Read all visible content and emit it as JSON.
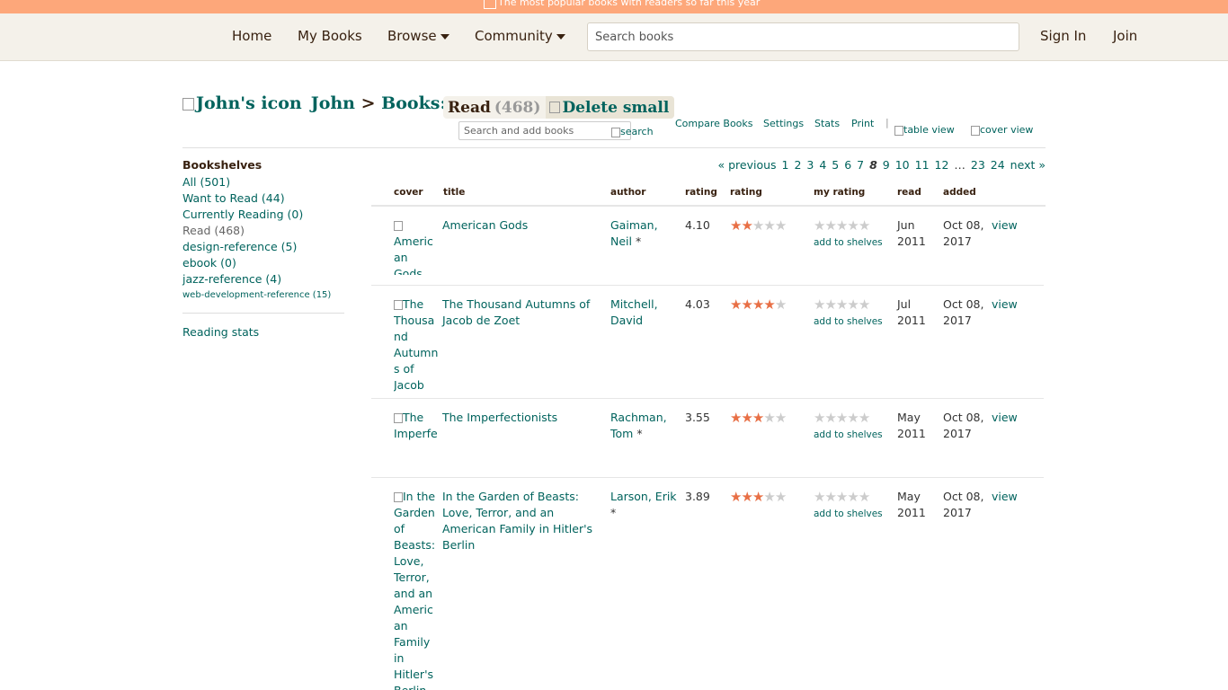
{
  "banner": {
    "text": "The most popular books with readers so far this year"
  },
  "nav": {
    "home": "Home",
    "my_books": "My Books",
    "browse": "Browse",
    "community": "Community",
    "search_placeholder": "Search books",
    "sign_in": "Sign In",
    "join": "Join"
  },
  "header": {
    "user_icon_alt": "John's icon",
    "user_name": "John",
    "separator": ">",
    "books_label": "Books:",
    "shelf_name": "Read",
    "shelf_count": "(468)",
    "delete_label": "Delete small",
    "add_books_placeholder": "Search and add books",
    "search_label": "search"
  },
  "controls": {
    "compare": "Compare Books",
    "settings": "Settings",
    "stats": "Stats",
    "print": "Print",
    "pipe": "|",
    "table_view": "table view",
    "cover_view": "cover view"
  },
  "sidebar": {
    "title": "Bookshelves",
    "shelves": [
      {
        "label": "All (501)"
      },
      {
        "label": "Want to Read (44)"
      },
      {
        "label": "Currently Reading (0)"
      },
      {
        "label": "Read (468)"
      },
      {
        "label": "design-reference (5)"
      },
      {
        "label": "ebook (0)"
      },
      {
        "label": "jazz-reference (4)"
      },
      {
        "label": "web-development-reference (15)"
      }
    ],
    "reading_stats": "Reading stats"
  },
  "pagination": {
    "previous": "« previous",
    "pages": [
      "1",
      "2",
      "3",
      "4",
      "5",
      "6",
      "7"
    ],
    "current": "8",
    "pages_after": [
      "9",
      "10",
      "11",
      "12"
    ],
    "ellipsis": "…",
    "last_pages": [
      "23",
      "24"
    ],
    "next": "next »"
  },
  "columns": {
    "cover": "cover",
    "title": "title",
    "author": "author",
    "avg_rating": "rating",
    "rating": "rating",
    "my_rating": "my rating",
    "read": "read",
    "added": "added"
  },
  "books": [
    {
      "cover_alt": "American Gods",
      "title": "American Gods",
      "author_line1": "Gaiman,",
      "author_line2": "Neil",
      "author_star": "*",
      "avg": "4.10",
      "rating_stars": 2,
      "read_month": "Jun",
      "read_year": "2011",
      "added_line1": "Oct 08,",
      "added_line2": "2017",
      "view": "view",
      "add_shelves": "add to shelves"
    },
    {
      "cover_alt": "The Thousand Autumns of Jacob de Zoet",
      "title": "The Thousand Autumns of Jacob de Zoet",
      "author_line1": "Mitchell,",
      "author_line2": "David",
      "author_star": "",
      "avg": "4.03",
      "rating_stars": 4,
      "read_month": "Jul",
      "read_year": "2011",
      "added_line1": "Oct 08,",
      "added_line2": "2017",
      "view": "view",
      "add_shelves": "add to shelves"
    },
    {
      "cover_alt": "The Imperfectionists",
      "title": "The Imperfectionists",
      "author_line1": "Rachman,",
      "author_line2": "Tom",
      "author_star": "*",
      "avg": "3.55",
      "rating_stars": 3,
      "read_month": "May",
      "read_year": "2011",
      "added_line1": "Oct 08,",
      "added_line2": "2017",
      "view": "view",
      "add_shelves": "add to shelves"
    },
    {
      "cover_alt": "In the Garden of Beasts: Love, Terror, and an American Family in Hitler's Berlin",
      "title": "In the Garden of Beasts: Love, Terror, and an American Family in Hitler's Berlin",
      "author_line1": "Larson, Erik",
      "author_line2": "",
      "author_star": "*",
      "avg": "3.89",
      "rating_stars": 3,
      "read_month": "May",
      "read_year": "2011",
      "added_line1": "Oct 08,",
      "added_line2": "2017",
      "view": "view",
      "add_shelves": "add to shelves"
    }
  ],
  "colors": {
    "banner": "#fda77a",
    "header_bg": "#f4f1ea",
    "link": "#00635d",
    "star_on": "#e86f45",
    "star_off": "#cccccc",
    "heading": "#382110"
  }
}
